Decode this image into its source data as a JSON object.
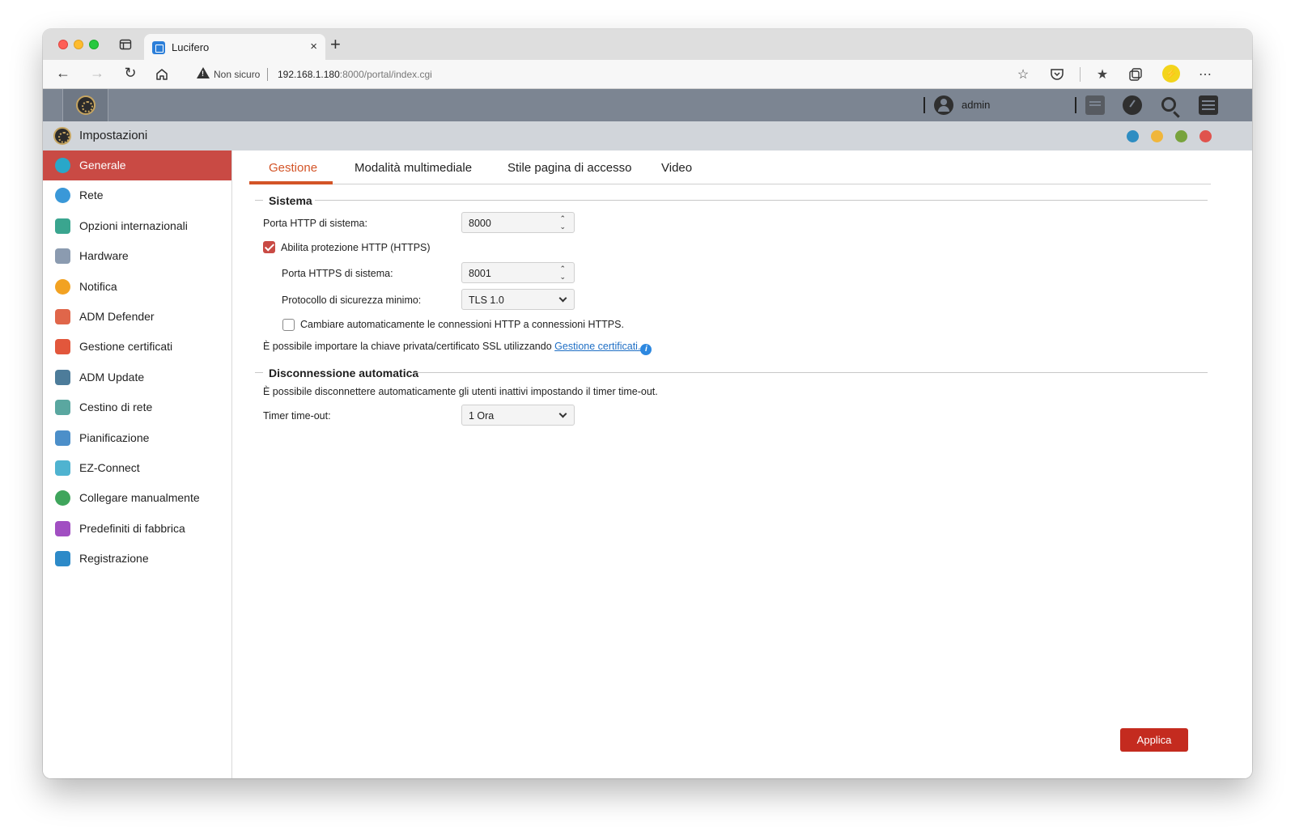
{
  "browser": {
    "tab_title": "Lucifero",
    "not_secure_label": "Non sicuro",
    "url_host": "192.168.1.180",
    "url_rest": ":8000/portal/index.cgi",
    "new_tab_glyph": "+",
    "close_glyph": "×"
  },
  "header": {
    "username": "admin"
  },
  "window": {
    "title": "Impostazioni",
    "dot_colors": [
      "#2e8dc2",
      "#f0b63b",
      "#78a33c",
      "#e0534d"
    ]
  },
  "sidebar": {
    "items": [
      {
        "label": "Generale",
        "icon": "general-icon",
        "color": "#29a7c9",
        "active": true
      },
      {
        "label": "Rete",
        "icon": "globe-icon",
        "color": "#3a98d8",
        "active": false
      },
      {
        "label": "Opzioni internazionali",
        "icon": "region-icon",
        "color": "#3aa58f",
        "active": false
      },
      {
        "label": "Hardware",
        "icon": "hardware-icon",
        "color": "#8b9bb0",
        "active": false
      },
      {
        "label": "Notifica",
        "icon": "alert-icon",
        "color": "#f2a222",
        "active": false
      },
      {
        "label": "ADM Defender",
        "icon": "firewall-icon",
        "color": "#e0664a",
        "active": false
      },
      {
        "label": "Gestione certificati",
        "icon": "certificate-icon",
        "color": "#e2573c",
        "active": false
      },
      {
        "label": "ADM Update",
        "icon": "update-icon",
        "color": "#4d7c9a",
        "active": false
      },
      {
        "label": "Cestino di rete",
        "icon": "recycle-bin-icon",
        "color": "#5aa7a0",
        "active": false
      },
      {
        "label": "Pianificazione",
        "icon": "calendar-icon",
        "color": "#4c8fc9",
        "active": false
      },
      {
        "label": "EZ-Connect",
        "icon": "cloud-icon",
        "color": "#4fb3d0",
        "active": false
      },
      {
        "label": "Collegare manualmente",
        "icon": "network-icon",
        "color": "#3fa55c",
        "active": false
      },
      {
        "label": "Predefiniti di fabbrica",
        "icon": "undo-icon",
        "color": "#a14fc2",
        "active": false
      },
      {
        "label": "Registrazione",
        "icon": "registration-icon",
        "color": "#2d8ac8",
        "active": false
      }
    ]
  },
  "tabs": [
    {
      "label": "Gestione",
      "active": true
    },
    {
      "label": "Modalità multimediale",
      "active": false
    },
    {
      "label": "Stile pagina di accesso",
      "active": false
    },
    {
      "label": "Video",
      "active": false
    }
  ],
  "system": {
    "title": "Sistema",
    "http_port_label": "Porta HTTP di sistema:",
    "http_port_value": "8000",
    "https_enable_label": "Abilita protezione HTTP (HTTPS)",
    "https_enabled": true,
    "https_port_label": "Porta HTTPS di sistema:",
    "https_port_value": "8001",
    "protocol_label": "Protocollo di sicurezza minimo:",
    "protocol_value": "TLS 1.0",
    "auto_redirect_label": "Cambiare automaticamente le connessioni HTTP a connessioni HTTPS.",
    "auto_redirect": false,
    "ssl_note": "È possibile importare la chiave privata/certificato SSL utilizzando",
    "ssl_link": "Gestione certificati."
  },
  "autologout": {
    "title": "Disconnessione automatica",
    "description": "È possibile disconnettere automaticamente gli utenti inattivi impostando il timer time-out.",
    "timer_label": "Timer time-out:",
    "timer_value": "1 Ora"
  },
  "apply_label": "Applica",
  "accent": "#c94a44"
}
